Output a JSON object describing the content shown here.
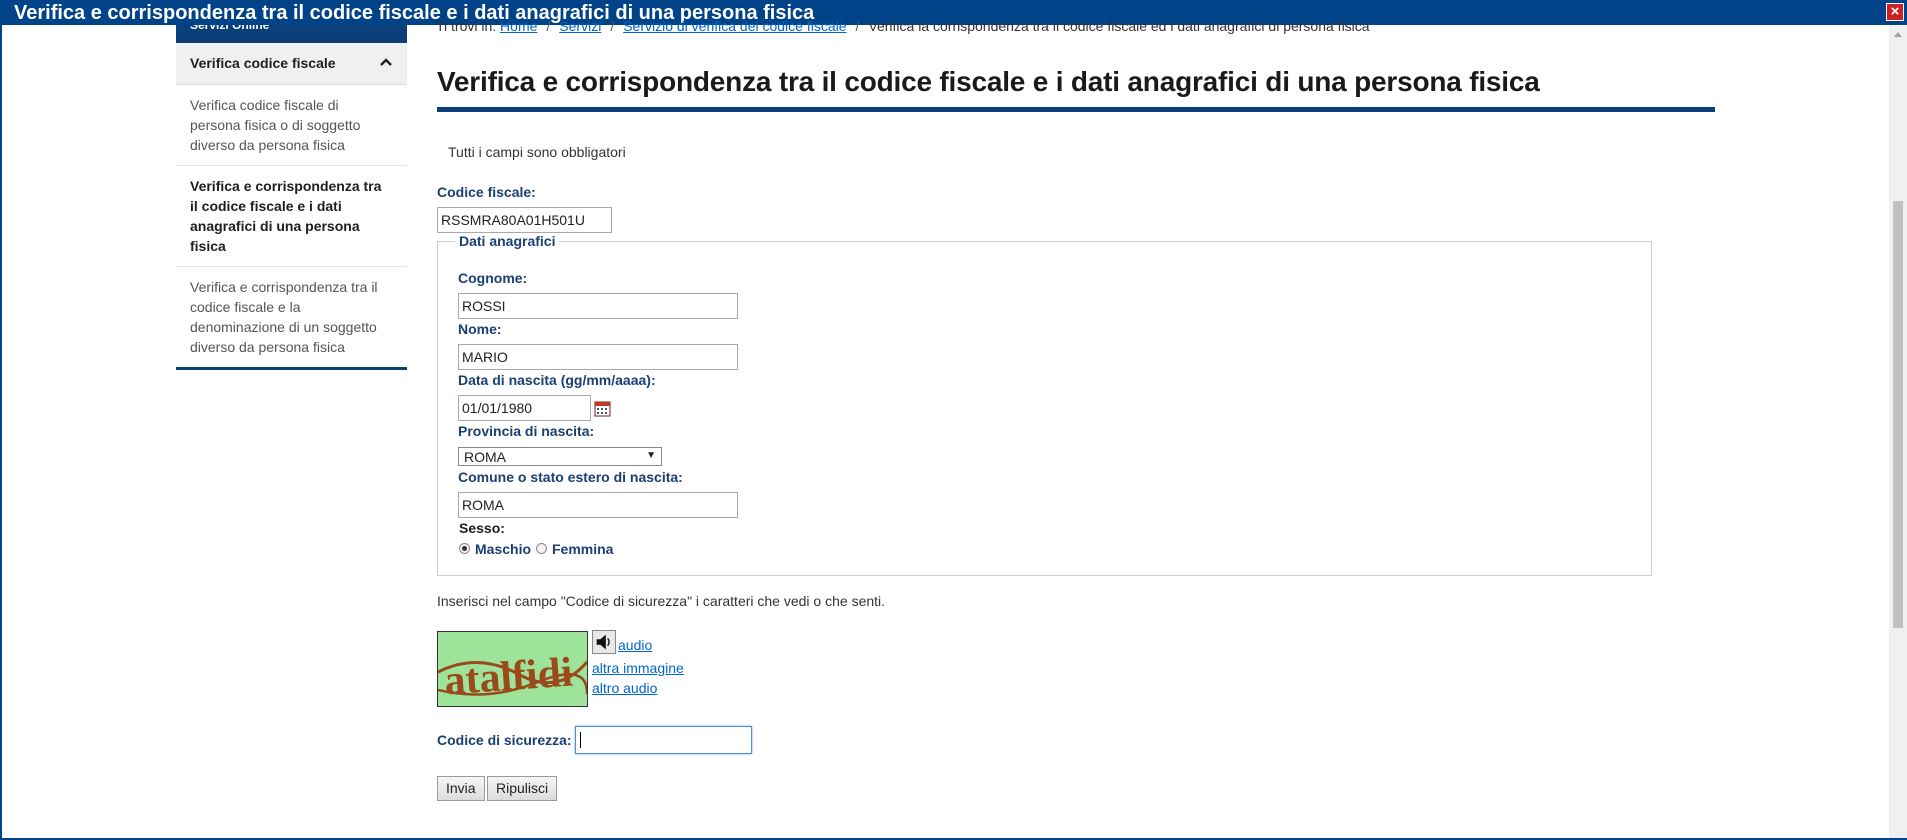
{
  "window": {
    "title": "Verifica e corrispondenza tra il codice fiscale e i dati anagrafici di una persona fisica",
    "close_glyph": "×"
  },
  "sidebar": {
    "top_label": "Servizi Online",
    "section_label": "Verifica codice fiscale",
    "items": [
      {
        "label": "Verifica codice fiscale di persona fisica o di soggetto diverso da persona fisica"
      },
      {
        "label": "Verifica e corrispondenza tra il codice fiscale e i dati anagrafici di una persona fisica"
      },
      {
        "label": "Verifica e corrispondenza tra il codice fiscale e la denominazione di un soggetto diverso da persona fisica"
      }
    ]
  },
  "breadcrumb": {
    "prefix": "Ti trovi in:",
    "links": [
      "Home",
      "Servizi",
      "Servizio di verifica del codice fiscale"
    ],
    "current": "Verifica la corrispondenza tra il codice fiscale ed i dati anagrafici di persona fisica"
  },
  "page": {
    "title": "Verifica e corrispondenza tra il codice fiscale e i dati anagrafici di una persona fisica",
    "required_note": "Tutti i campi sono obbligatori"
  },
  "form": {
    "codice_fiscale": {
      "label": "Codice fiscale:",
      "value": "RSSMRA80A01H501U"
    },
    "fieldset_legend": "Dati anagrafici",
    "cognome": {
      "label": "Cognome:",
      "value": "ROSSI"
    },
    "nome": {
      "label": "Nome:",
      "value": "MARIO"
    },
    "data_nascita": {
      "label": "Data di nascita (gg/mm/aaaa):",
      "value": "01/01/1980"
    },
    "provincia": {
      "label": "Provincia di nascita:",
      "value": "ROMA"
    },
    "comune": {
      "label": "Comune o stato estero di nascita:",
      "value": "ROMA"
    },
    "sesso": {
      "label": "Sesso:",
      "options": [
        "Maschio",
        "Femmina"
      ],
      "selected": "Maschio"
    }
  },
  "captcha": {
    "instruction": "Inserisci nel campo \"Codice di sicurezza\" i caratteri che vedi o che senti.",
    "image_text": "atalfidi",
    "links": {
      "audio": "audio",
      "new_image": "altra immagine",
      "new_audio": "altro audio"
    },
    "security_label": "Codice di sicurezza:",
    "security_value": ""
  },
  "buttons": {
    "submit": "Invia",
    "reset": "Ripulisci"
  },
  "colors": {
    "brand_blue": "#014388",
    "label_blue": "#1b3f73",
    "link_blue": "#0066cc",
    "captcha_bg": "#9ee39a",
    "captcha_text": "#9a4a1a"
  }
}
